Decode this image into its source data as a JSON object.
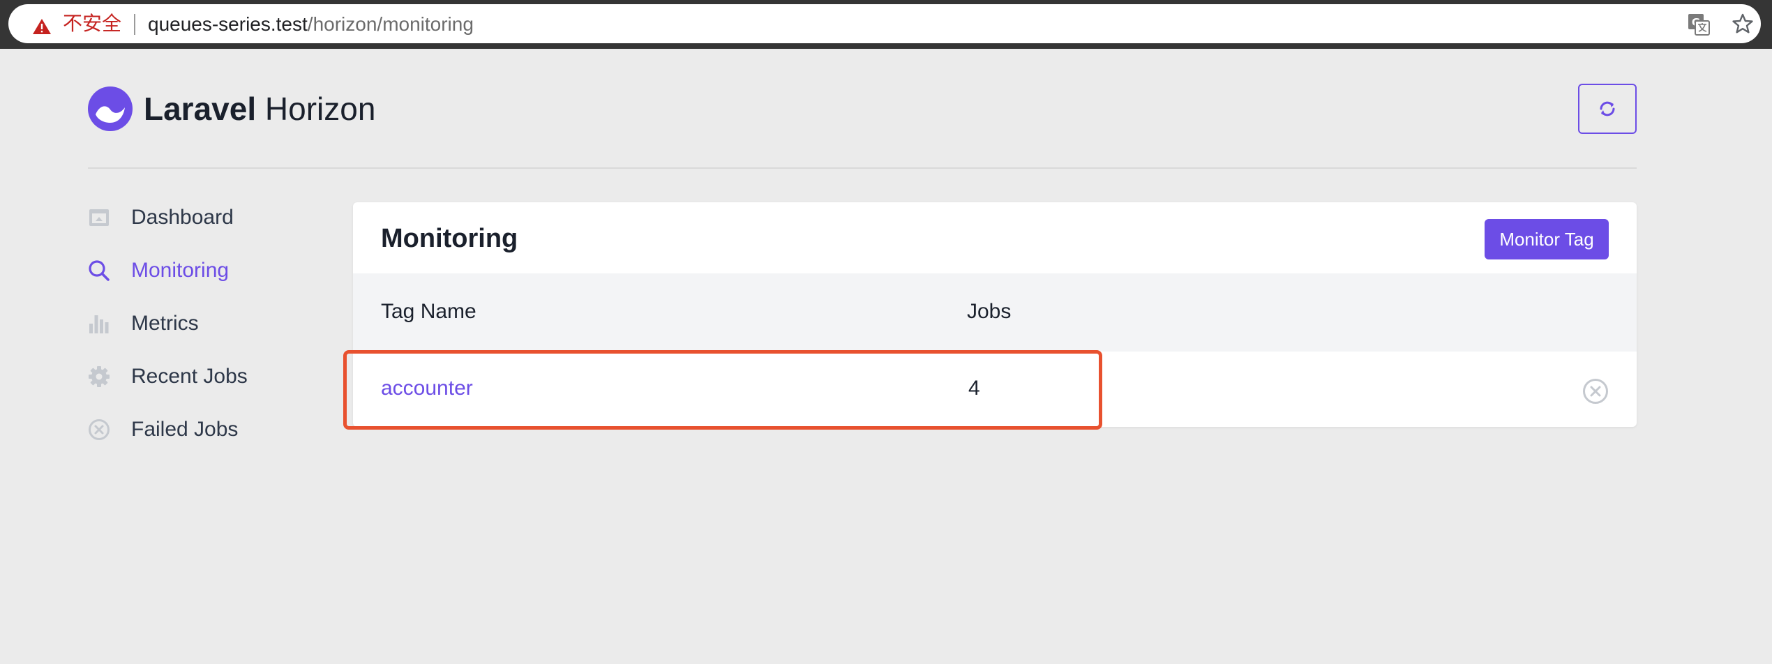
{
  "browser": {
    "security_label": "不安全",
    "url_host": "queues-series.test",
    "url_path": "/horizon/monitoring",
    "icons": {
      "warning": "warning-triangle-icon",
      "translate": "translate-icon",
      "bookmark": "star-icon"
    }
  },
  "header": {
    "brand_strong": "Laravel",
    "brand_light": "Horizon",
    "logo_icon": "horizon-logo-icon",
    "refresh_icon": "refresh-icon"
  },
  "sidebar": {
    "items": [
      {
        "label": "Dashboard",
        "icon": "dashboard-icon",
        "active": false
      },
      {
        "label": "Monitoring",
        "icon": "search-icon",
        "active": true
      },
      {
        "label": "Metrics",
        "icon": "bar-chart-icon",
        "active": false
      },
      {
        "label": "Recent Jobs",
        "icon": "gear-icon",
        "active": false
      },
      {
        "label": "Failed Jobs",
        "icon": "x-circle-icon",
        "active": false
      }
    ]
  },
  "main": {
    "title": "Monitoring",
    "monitor_tag_button": "Monitor Tag",
    "table": {
      "columns": [
        "Tag Name",
        "Jobs"
      ],
      "rows": [
        {
          "tag": "accounter",
          "jobs": "4"
        }
      ]
    }
  },
  "colors": {
    "accent": "#6c4de6",
    "background": "#ebebeb",
    "highlight": "#e8512f",
    "insecure": "#c5221f"
  }
}
